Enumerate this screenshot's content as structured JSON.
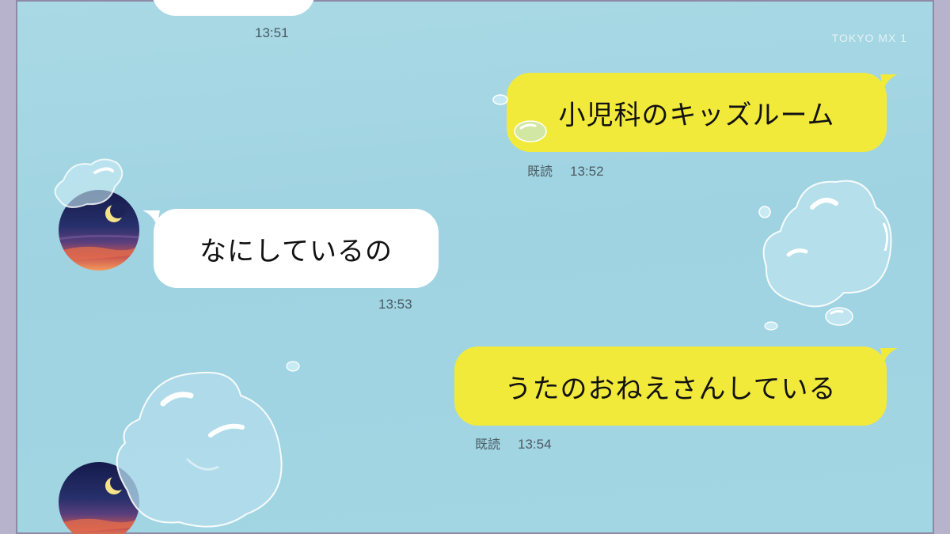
{
  "watermark": "TOKYO MX 1",
  "messages": [
    {
      "direction": "incoming",
      "text": "",
      "time": "13:51"
    },
    {
      "direction": "outgoing",
      "text": "小児科のキッズルーム",
      "read": "既読",
      "time": "13:52"
    },
    {
      "direction": "incoming",
      "text": "なにしているの",
      "time": "13:53"
    },
    {
      "direction": "outgoing",
      "text": "うたのおねえさんしている",
      "read": "既読",
      "time": "13:54"
    }
  ],
  "colors": {
    "background": "#a9d9e5",
    "outgoing_bubble": "#f2ea3a",
    "incoming_bubble": "#ffffff",
    "meta_text": "#4a5a63"
  },
  "icons": [
    "moon-icon",
    "water-drop-icon"
  ]
}
